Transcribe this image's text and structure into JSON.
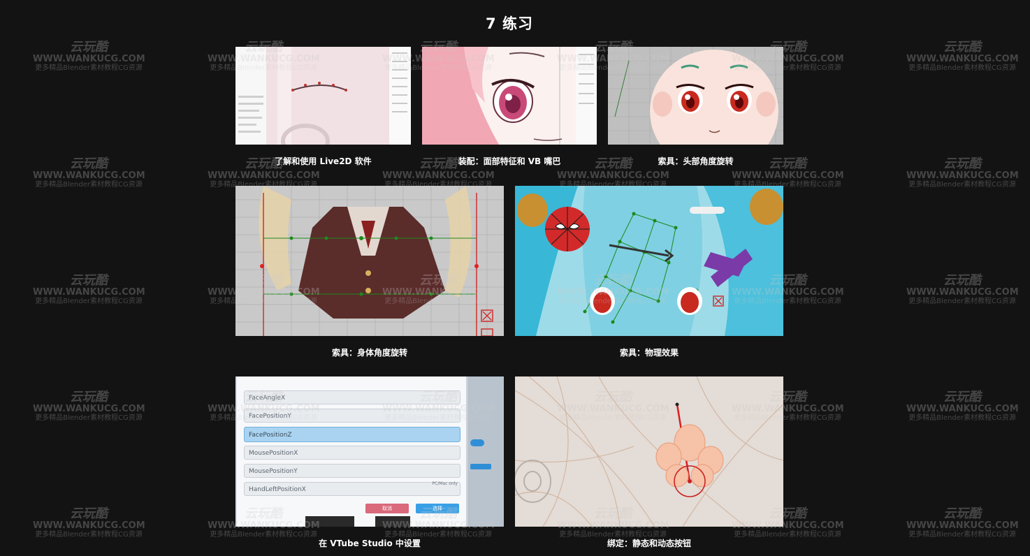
{
  "section": {
    "title": "7 练习"
  },
  "watermark": {
    "logo": "云玩酷",
    "url": "WWW.WANKUCG.COM",
    "tagline": "更多精品Blender素材教程CG资源"
  },
  "cards": [
    {
      "caption": "了解和使用 Live2D 软件"
    },
    {
      "caption": "装配：面部特征和 VB 嘴巴"
    },
    {
      "caption": "索具：头部角度旋转"
    },
    {
      "caption": "索具：身体角度旋转"
    },
    {
      "caption": "索具：物理效果"
    },
    {
      "caption": "在 VTube Studio 中设置"
    },
    {
      "caption": "绑定：静态和动态按钮"
    }
  ],
  "vtube_params": {
    "items": [
      "FaceAngleX",
      "FacePositionY",
      "FacePositionZ",
      "MousePositionX",
      "MousePositionY",
      "HandLeftPositionX"
    ],
    "selected": "FacePositionZ",
    "note": "PC/Mac only",
    "cancel_label": "取消",
    "ok_label": "选择"
  },
  "colors": {
    "background": "#131313",
    "caption": "#ffffff",
    "selected_param": "#a9d3f0",
    "cancel_button": "#d9697b",
    "ok_button": "#3aa0e6"
  }
}
